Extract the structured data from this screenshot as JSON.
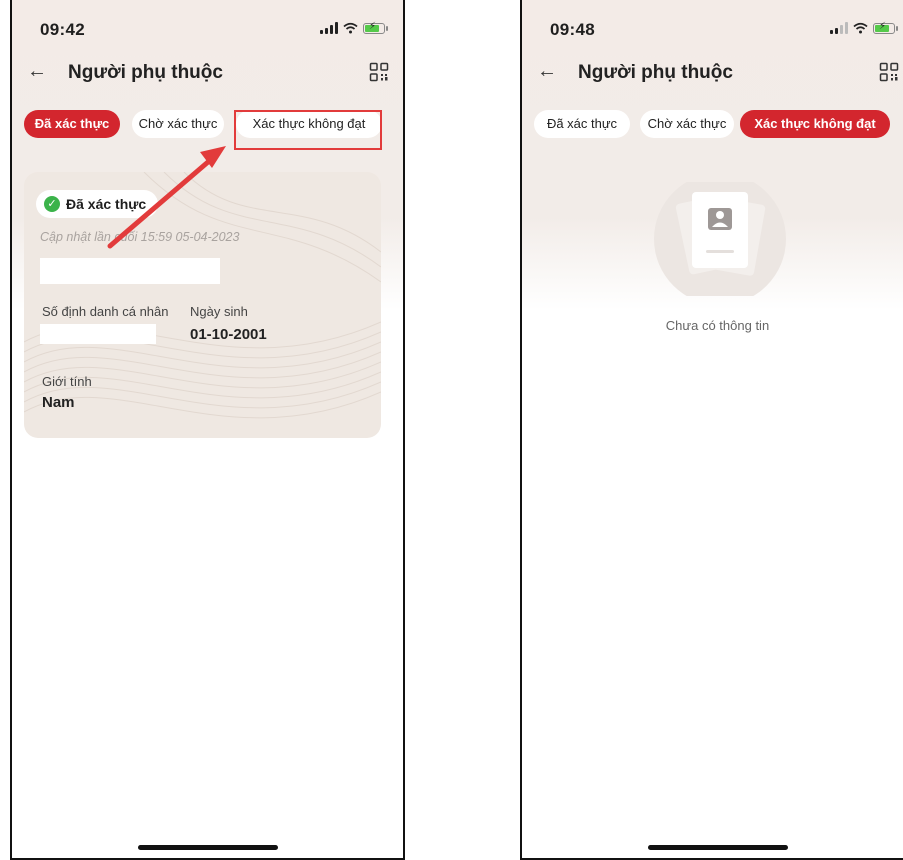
{
  "left": {
    "status": {
      "time": "09:42"
    },
    "header": {
      "title": "Người phụ thuộc",
      "back_icon": "arrow-left-icon",
      "qr_icon": "qr-code-icon"
    },
    "tabs": [
      {
        "label": "Đã xác thực",
        "active": true
      },
      {
        "label": "Chờ xác thực",
        "active": false
      },
      {
        "label": "Xác thực không đạt",
        "active": false
      }
    ],
    "card": {
      "badge": "Đã xác thực",
      "updated": "Cập nhật lần cuối 15:59 05-04-2023",
      "id_label": "Số định danh cá nhân",
      "dob_label": "Ngày sinh",
      "dob_value": "01-10-2001",
      "gender_label": "Giới tính",
      "gender_value": "Nam"
    }
  },
  "right": {
    "status": {
      "time": "09:48"
    },
    "header": {
      "title": "Người phụ thuộc",
      "back_icon": "arrow-left-icon",
      "qr_icon": "qr-code-icon"
    },
    "tabs": [
      {
        "label": "Đã xác thực",
        "active": false
      },
      {
        "label": "Chờ xác thực",
        "active": false
      },
      {
        "label": "Xác thực không đạt",
        "active": true
      }
    ],
    "empty_text": "Chưa có thông tin"
  },
  "colors": {
    "accent": "#d3262e",
    "annotation": "#e23b3b",
    "success": "#3bb34a"
  }
}
